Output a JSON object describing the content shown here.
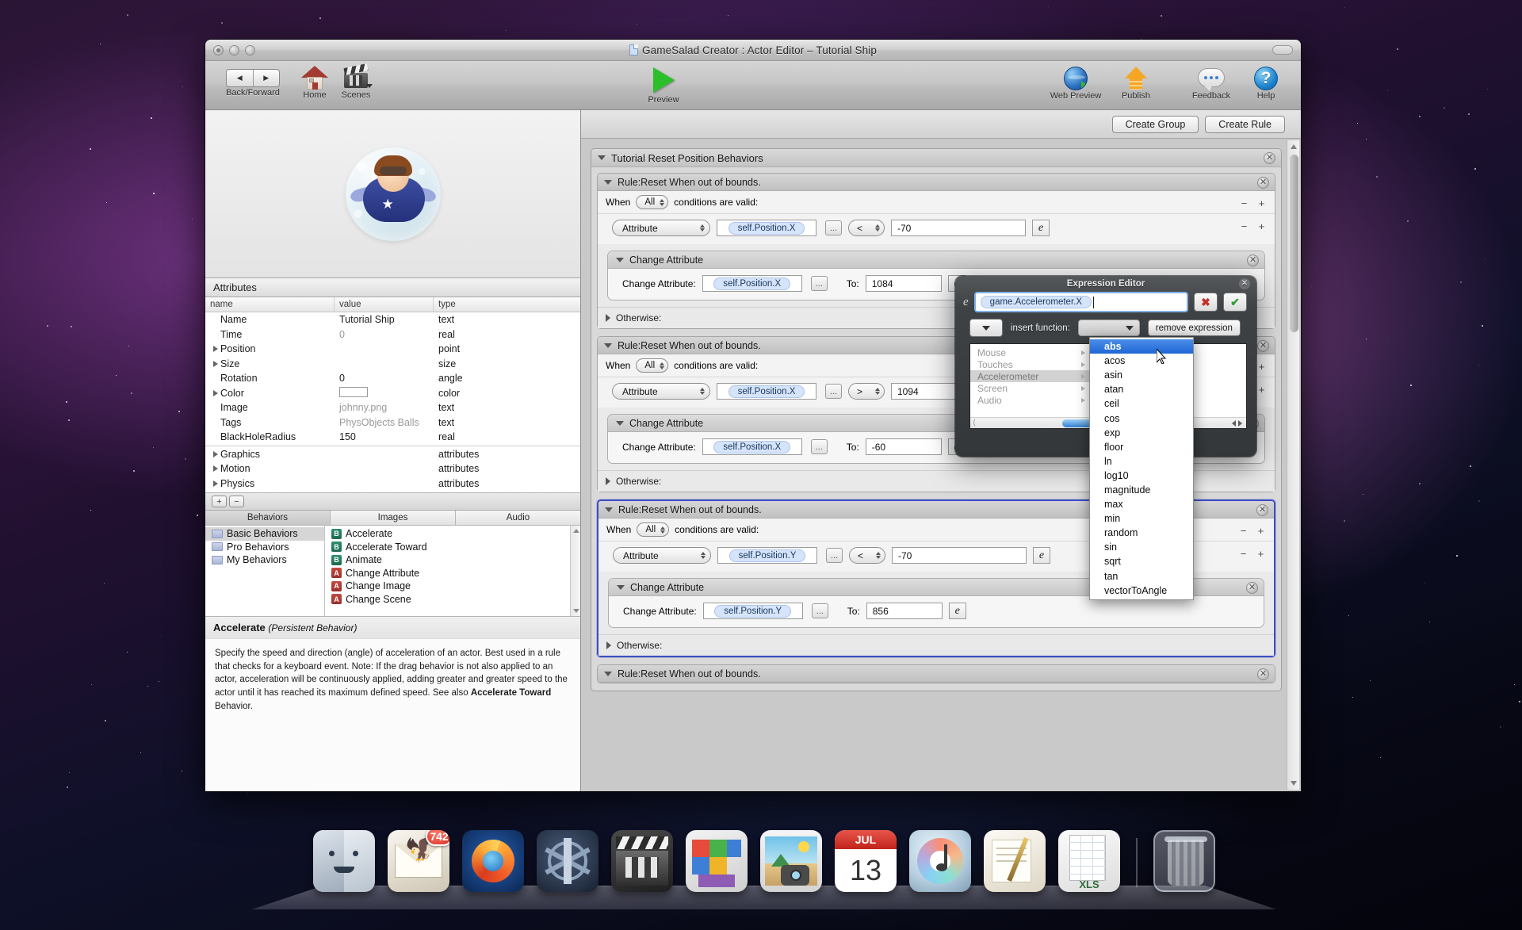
{
  "window": {
    "title": "GameSalad Creator : Actor Editor – Tutorial Ship"
  },
  "toolbar": {
    "back_forward_label": "Back/Forward",
    "back_glyph": "◀",
    "forward_glyph": "▶",
    "home_label": "Home",
    "scenes_label": "Scenes",
    "preview_label": "Preview",
    "web_preview_label": "Web Preview",
    "publish_label": "Publish",
    "feedback_label": "Feedback",
    "help_label": "Help",
    "help_glyph": "?"
  },
  "left_pane": {
    "attributes_header": "Attributes",
    "columns": [
      "name",
      "value",
      "type"
    ],
    "rows": [
      {
        "name": "Name",
        "value": "Tutorial Ship",
        "type": "text",
        "disclosure": false,
        "muted": false
      },
      {
        "name": "Time",
        "value": "0",
        "type": "real",
        "disclosure": false,
        "muted": true
      },
      {
        "name": "Position",
        "value": "",
        "type": "point",
        "disclosure": true,
        "muted": false
      },
      {
        "name": "Size",
        "value": "",
        "type": "size",
        "disclosure": true,
        "muted": false
      },
      {
        "name": "Rotation",
        "value": "0",
        "type": "angle",
        "disclosure": false,
        "muted": false
      },
      {
        "name": "Color",
        "value": "",
        "type": "color",
        "disclosure": true,
        "muted": false,
        "swatch": true
      },
      {
        "name": "Image",
        "value": "johnny.png",
        "type": "text",
        "disclosure": false,
        "muted": true
      },
      {
        "name": "Tags",
        "value": "PhysObjects  Balls",
        "type": "text",
        "disclosure": false,
        "muted": true
      },
      {
        "name": "BlackHoleRadius",
        "value": "150",
        "type": "real",
        "disclosure": false,
        "muted": false
      }
    ],
    "group_rows": [
      {
        "name": "Graphics",
        "value": "",
        "type": "attributes",
        "disclosure": true
      },
      {
        "name": "Motion",
        "value": "",
        "type": "attributes",
        "disclosure": true
      },
      {
        "name": "Physics",
        "value": "",
        "type": "attributes",
        "disclosure": true
      }
    ],
    "add_attribute_label": "+",
    "remove_attribute_label": "−",
    "browser_tabs": [
      {
        "label": "Behaviors",
        "selected": true
      },
      {
        "label": "Images",
        "selected": false
      },
      {
        "label": "Audio",
        "selected": false
      }
    ],
    "behavior_folders": [
      {
        "label": "Basic Behaviors",
        "selected": true
      },
      {
        "label": "Pro Behaviors",
        "selected": false
      },
      {
        "label": "My Behaviors",
        "selected": false
      }
    ],
    "behavior_items": [
      {
        "label": "Accelerate",
        "badge": "B",
        "kind": "behavior"
      },
      {
        "label": "Accelerate Toward",
        "badge": "B",
        "kind": "behavior"
      },
      {
        "label": "Animate",
        "badge": "B",
        "kind": "behavior"
      },
      {
        "label": "Change Attribute",
        "badge": "A",
        "kind": "action"
      },
      {
        "label": "Change Image",
        "badge": "A",
        "kind": "action"
      },
      {
        "label": "Change Scene",
        "badge": "A",
        "kind": "action"
      }
    ],
    "description": {
      "title": "Accelerate",
      "subtitle": "(Persistent Behavior)",
      "body_part1": "Specify the speed and direction (angle) of acceleration of an actor. Best used in a rule that checks for a keyboard event. Note: If the drag behavior is not also applied to an actor, acceleration will be continuously applied, adding greater and greater speed to the actor until it has reached its maximum defined speed. See also ",
      "body_bold": "Accelerate Toward",
      "body_part2": " Behavior."
    }
  },
  "right_pane": {
    "create_group_label": "Create Group",
    "create_rule_label": "Create Rule",
    "group_title": "Tutorial Reset Position Behaviors",
    "when_label": "When",
    "conditions_label": "conditions are valid:",
    "all_label": "All",
    "attribute_label": "Attribute",
    "dots_label": "...",
    "change_attribute_header": "Change Attribute",
    "change_attribute_label": "Change Attribute:",
    "to_label": "To:",
    "otherwise_label": "Otherwise:",
    "expr_btn_glyph": "e",
    "rules": [
      {
        "title": "Rule:Reset When out of bounds.",
        "cond_attribute": "self.Position.X",
        "cond_operator": "<",
        "cond_value": "-70",
        "action_attribute": "self.Position.X",
        "action_value": "1084",
        "selected": false
      },
      {
        "title": "Rule:Reset When out of bounds.",
        "cond_attribute": "self.Position.X",
        "cond_operator": ">",
        "cond_value": "1094",
        "action_attribute": "self.Position.X",
        "action_value": "-60",
        "selected": false
      },
      {
        "title": "Rule:Reset When out of bounds.",
        "cond_attribute": "self.Position.Y",
        "cond_operator": "<",
        "cond_value": "-70",
        "action_attribute": "self.Position.Y",
        "action_value": "856",
        "selected": true
      },
      {
        "title": "Rule:Reset When out of bounds.",
        "cond_attribute": "",
        "cond_operator": "",
        "cond_value": "",
        "action_attribute": "",
        "action_value": "",
        "selected": false
      }
    ]
  },
  "expression_editor": {
    "title": "Expression Editor",
    "equals_glyph": "e",
    "expression_token": "game.Accelerometer.X",
    "cancel_glyph": "✖",
    "accept_glyph": "✔",
    "insert_function_label": "insert function:",
    "remove_expression_label": "remove expression",
    "function_value": "",
    "browser_items": [
      {
        "label": "Mouse",
        "selected": false
      },
      {
        "label": "Touches",
        "selected": false
      },
      {
        "label": "Accelerometer",
        "selected": true
      },
      {
        "label": "Screen",
        "selected": false
      },
      {
        "label": "Audio",
        "selected": false
      }
    ]
  },
  "function_menu": {
    "items": [
      {
        "label": "abs",
        "selected": true
      },
      {
        "label": "acos",
        "selected": false
      },
      {
        "label": "asin",
        "selected": false
      },
      {
        "label": "atan",
        "selected": false
      },
      {
        "label": "ceil",
        "selected": false
      },
      {
        "label": "cos",
        "selected": false
      },
      {
        "label": "exp",
        "selected": false
      },
      {
        "label": "floor",
        "selected": false
      },
      {
        "label": "ln",
        "selected": false
      },
      {
        "label": "log10",
        "selected": false
      },
      {
        "label": "magnitude",
        "selected": false
      },
      {
        "label": "max",
        "selected": false
      },
      {
        "label": "min",
        "selected": false
      },
      {
        "label": "random",
        "selected": false
      },
      {
        "label": "sin",
        "selected": false
      },
      {
        "label": "sqrt",
        "selected": false
      },
      {
        "label": "tan",
        "selected": false
      },
      {
        "label": "vectorToAngle",
        "selected": false
      }
    ]
  },
  "dock": {
    "items": [
      {
        "name": "finder",
        "label": "Finder",
        "badge": ""
      },
      {
        "name": "mail",
        "label": "Mail",
        "badge": "742"
      },
      {
        "name": "firefox",
        "label": "Firefox",
        "badge": ""
      },
      {
        "name": "gamesalad",
        "label": "GameSalad Creator",
        "badge": ""
      },
      {
        "name": "imovie",
        "label": "iMovie",
        "badge": ""
      },
      {
        "name": "tetris",
        "label": "Tetris",
        "badge": ""
      },
      {
        "name": "iphoto",
        "label": "iPhoto",
        "badge": ""
      },
      {
        "name": "ical",
        "label": "iCal",
        "badge": "13",
        "month": "JUL"
      },
      {
        "name": "itunes",
        "label": "iTunes",
        "badge": ""
      },
      {
        "name": "notes",
        "label": "Notes",
        "badge": ""
      },
      {
        "name": "excel",
        "label": "XLS",
        "badge": ""
      },
      {
        "name": "trash",
        "label": "Trash",
        "badge": ""
      }
    ],
    "ical_month": "JUL",
    "ical_day": "13",
    "xls_label": "XLS",
    "mail_badge": "742"
  },
  "colors": {
    "accent_blue": "#1f66d6",
    "token_blue": "#d6e4fa",
    "selection_border": "#3b4fc4",
    "behavior_green": "#1d6a4e",
    "action_red": "#9a2f2a"
  }
}
